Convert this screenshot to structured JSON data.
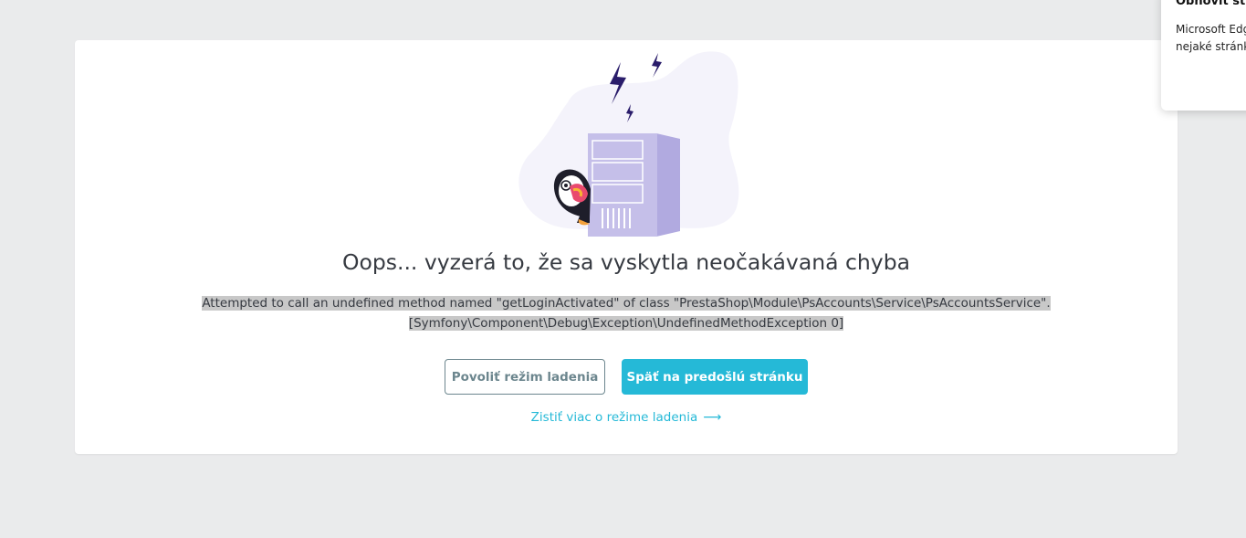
{
  "error_page": {
    "title": "Oops... vyzerá to, že sa vyskytla neočakávaná chyba",
    "message_line1": "Attempted to call an undefined method named \"getLoginActivated\" of class \"PrestaShop\\Module\\PsAccounts\\Service\\PsAccountsService\".",
    "message_line2": "[Symfony\\Component\\Debug\\Exception\\UndefinedMethodException 0]",
    "enable_debug_label": "Povoliť režim ladenia",
    "back_label": "Späť na predošlú stránku",
    "learn_more_label": "Zistiť viac o režime ladenia",
    "learn_more_arrow": "⟶"
  },
  "notification": {
    "title": "Obnoviť str",
    "body_line1": "Microsoft Edg",
    "body_line2": "nejaké stránky"
  },
  "colors": {
    "accent": "#25b9d7",
    "outline": "#6c868e",
    "text": "#363a41",
    "server": "#c5bfe9",
    "blob": "#f4f3fb"
  }
}
